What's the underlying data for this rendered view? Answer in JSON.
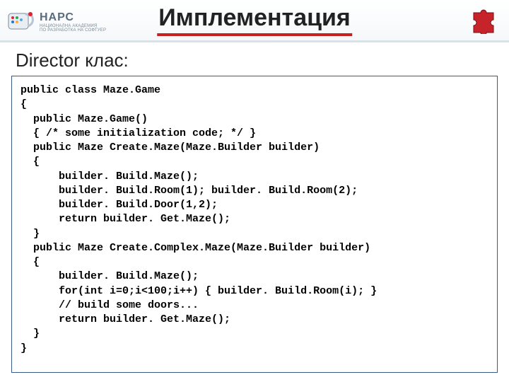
{
  "header": {
    "logo_text": "НАРС",
    "logo_sub": "НАЦИОНАЛНА АКАДЕМИЯ\nПО РАЗРАБОТКА НА СОФТУЕР"
  },
  "title": "Имплементация",
  "subtitle": "Director клас:",
  "code": "public class Maze.Game\n{\n  public Maze.Game()\n  { /* some initialization code; */ }\n  public Maze Create.Maze(Maze.Builder builder)\n  {\n      builder. Build.Maze();\n      builder. Build.Room(1); builder. Build.Room(2);\n      builder. Build.Door(1,2);\n      return builder. Get.Maze();\n  }\n  public Maze Create.Complex.Maze(Maze.Builder builder)\n  {\n      builder. Build.Maze();\n      for(int i=0;i<100;i++) { builder. Build.Room(i); }\n      // build some doors...\n      return builder. Get.Maze();\n  }\n}"
}
